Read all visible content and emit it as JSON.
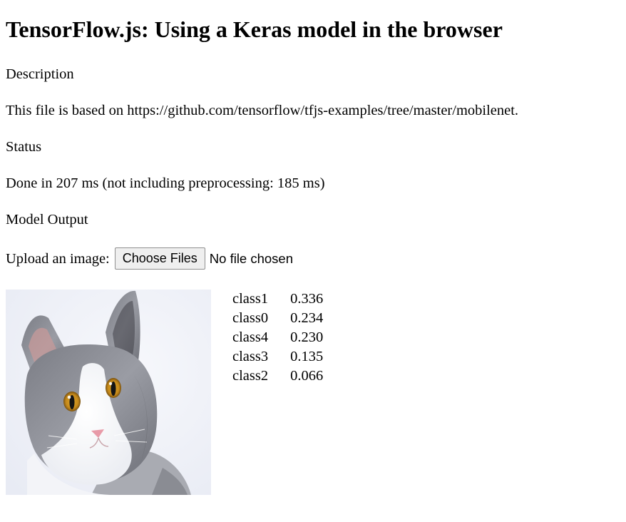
{
  "page": {
    "title": "TensorFlow.js: Using a Keras model in the browser",
    "description_heading": "Description",
    "description_text": "This file is based on https://github.com/tensorflow/tfjs-examples/tree/master/mobilenet.",
    "status_heading": "Status",
    "status_text": "Done in 207 ms (not including preprocessing: 185 ms)",
    "model_output_heading": "Model Output"
  },
  "upload": {
    "label": "Upload an image:",
    "button_label": "Choose Files",
    "status": "No file chosen"
  },
  "image": {
    "subject": "gray and white cat",
    "icon": "cat-photo"
  },
  "predictions": [
    {
      "class": "class1",
      "score": "0.336"
    },
    {
      "class": "class0",
      "score": "0.234"
    },
    {
      "class": "class4",
      "score": "0.230"
    },
    {
      "class": "class3",
      "score": "0.135"
    },
    {
      "class": "class2",
      "score": "0.066"
    }
  ]
}
